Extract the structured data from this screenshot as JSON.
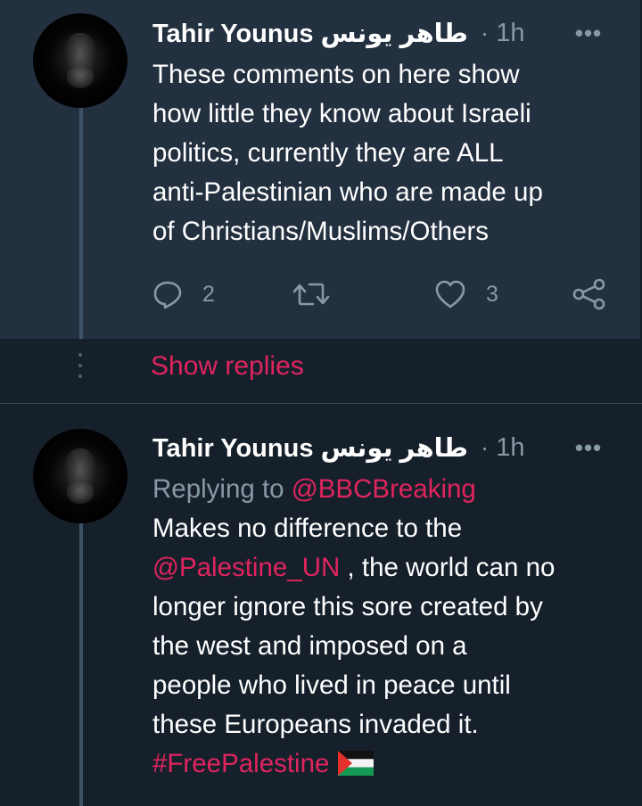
{
  "tweets": [
    {
      "author": "Tahir Younus طاهر يونس",
      "separator": "·",
      "time": "1h",
      "more_label": "•••",
      "body_lines": [
        "These comments on here show",
        "how little they know about Israeli",
        "politics, currently they are ALL",
        "anti-Palestinian who are made up",
        "of Christians/Muslims/Others"
      ],
      "actions": {
        "reply_icon": "reply-icon",
        "reply_count": "2",
        "retweet_icon": "retweet-icon",
        "like_icon": "heart-icon",
        "like_count": "3",
        "share_icon": "share-icon"
      }
    },
    {
      "author": "Tahir Younus طاهر يونس",
      "separator": "·",
      "time": "1h",
      "more_label": "•••",
      "replying_prefix": "Replying to ",
      "replying_to": "@BBCBreaking",
      "body": {
        "line1": "Makes no difference to the",
        "line2_mention": "@Palestine_UN",
        "line2_rest": " , the world can no",
        "line3": "longer ignore this sore created by",
        "line4": "the west and imposed on a",
        "line5": "people who lived in peace until",
        "line6": "these Europeans invaded it.",
        "hashtag": "#FreePalestine",
        "flag_icon": "palestine-flag-emoji"
      }
    }
  ],
  "show_replies_label": "Show replies",
  "colors": {
    "background": "#15202b",
    "highlighted_tweet_bg": "#233040",
    "accent": "#e0245e",
    "muted": "#8899a6",
    "thread_line": "#3d5466"
  }
}
